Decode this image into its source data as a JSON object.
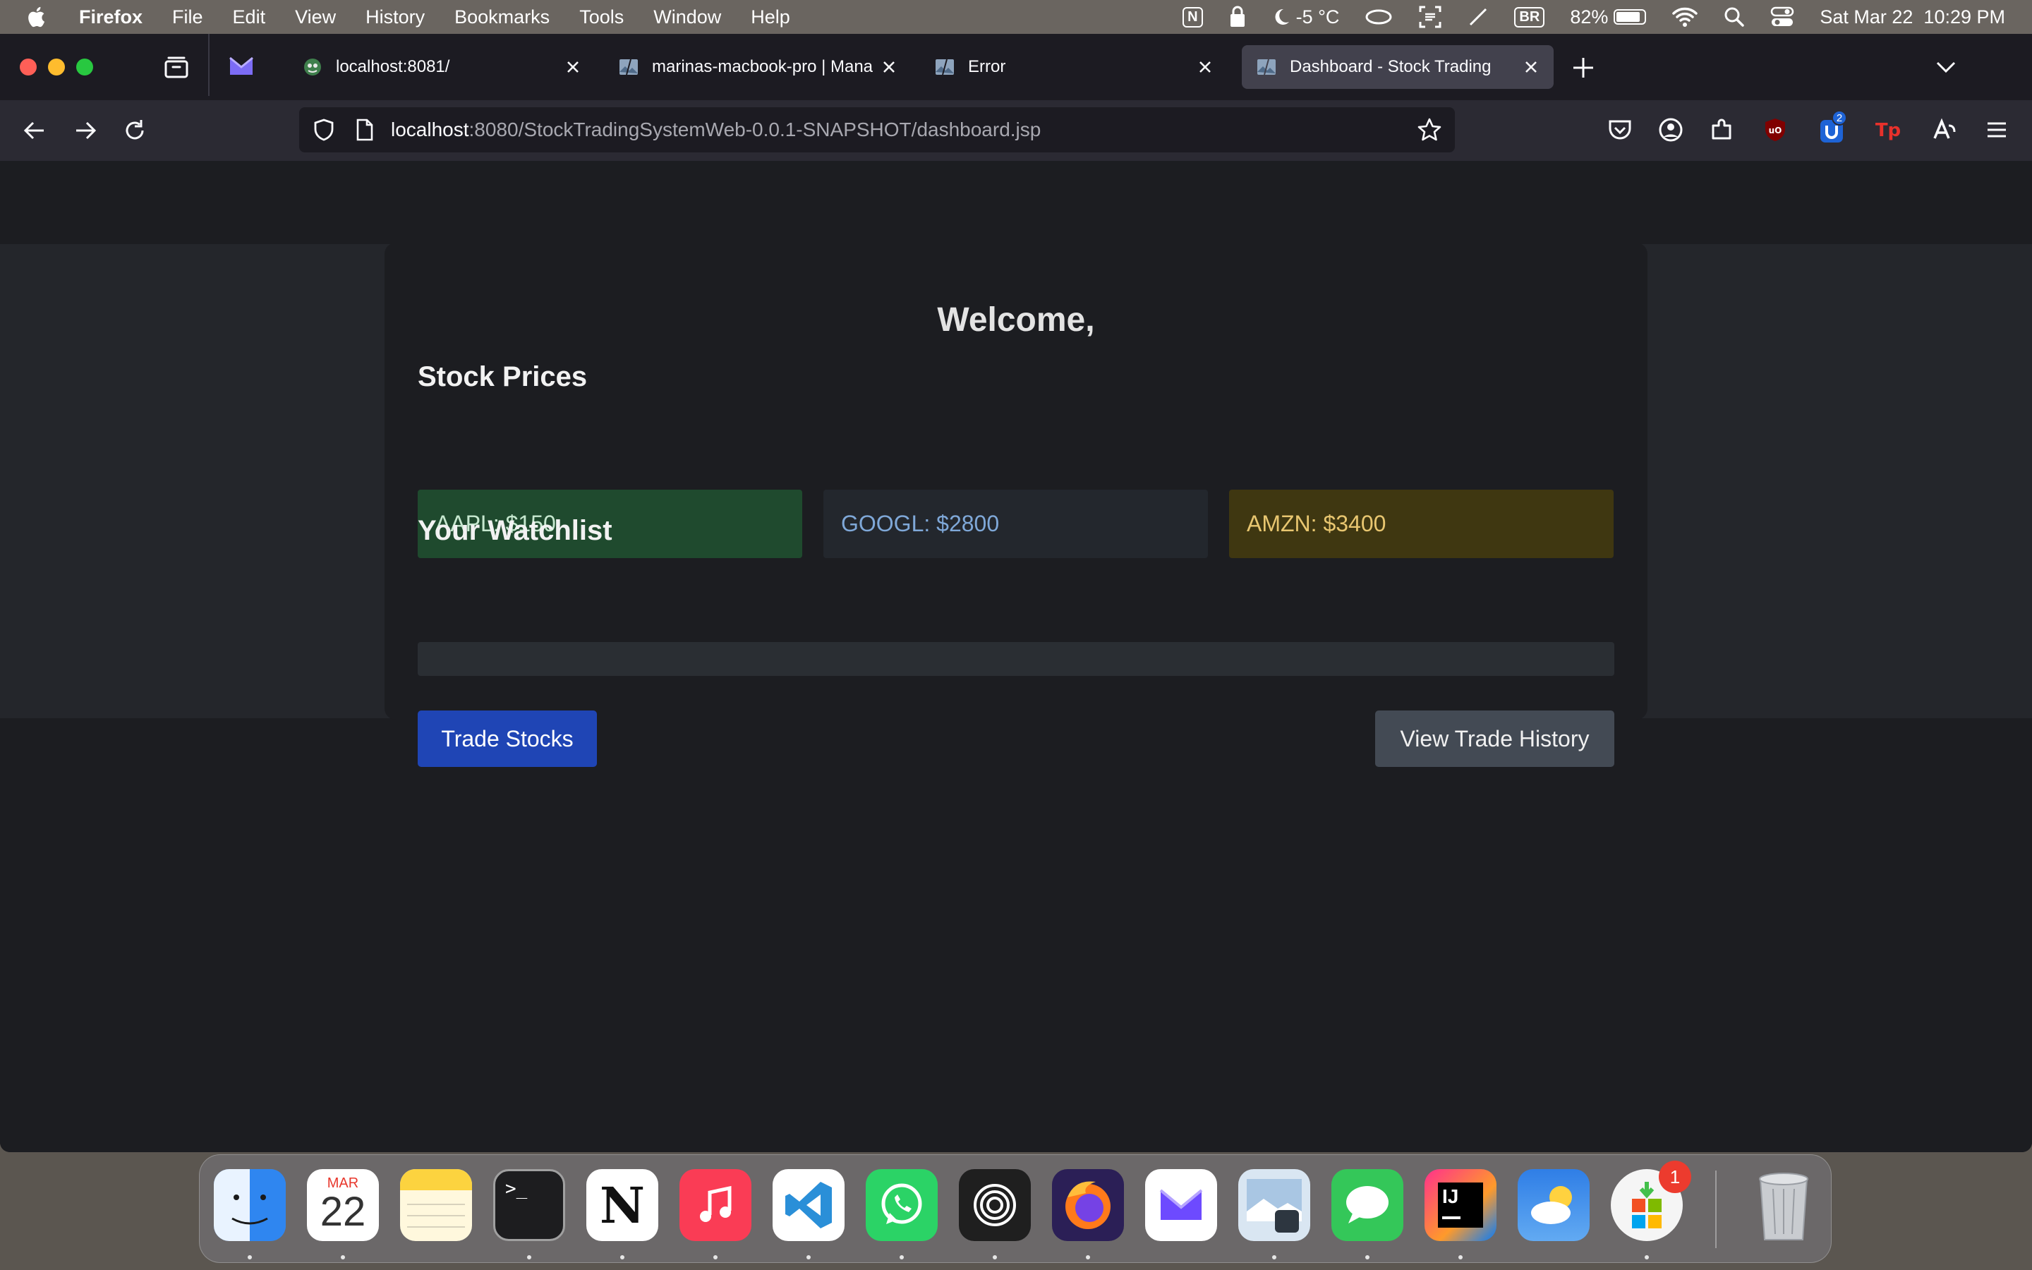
{
  "menubar": {
    "app_name": "Firefox",
    "menus": [
      "File",
      "Edit",
      "View",
      "History",
      "Bookmarks",
      "Tools",
      "Window",
      "Help"
    ],
    "temperature": "-5 °C",
    "keyboard_layout": "BR",
    "battery_percent": "82%",
    "battery_level": 0.82,
    "datetime": "Sat Mar 22  10:29 PM"
  },
  "browser": {
    "tabs": [
      {
        "label": "localhost:8081/",
        "icon": "hosting-favicon-icon"
      },
      {
        "label": "marinas-macbook-pro | Manage",
        "icon": "broken-image-favicon-icon"
      },
      {
        "label": "Error",
        "icon": "broken-image-favicon-icon"
      },
      {
        "label": "Dashboard - Stock Trading",
        "icon": "broken-image-favicon-icon"
      }
    ],
    "url": {
      "host": "localhost",
      "path": ":8080/StockTradingSystemWeb-0.0.1-SNAPSHOT/dashboard.jsp"
    },
    "extension_badge": "2"
  },
  "page": {
    "welcome": "Welcome,",
    "stock_prices_title": "Stock Prices",
    "stocks": [
      {
        "text": "AAPL: $150",
        "color": "#1f4a2e"
      },
      {
        "text": "GOOGL: $2800",
        "color": "#23272d"
      },
      {
        "text": "AMZN: $3400",
        "color": "#3f3711"
      }
    ],
    "watchlist_title": "Your Watchlist",
    "trade_button": "Trade Stocks",
    "history_button": "View Trade History"
  },
  "dock": {
    "calendar_month": "MAR",
    "calendar_day": "22",
    "badge_count": "1",
    "apps": [
      "finder-icon",
      "calendar-icon",
      "notes-icon",
      "terminal-icon",
      "notion-icon",
      "music-icon",
      "vscode-icon",
      "whatsapp-icon",
      "perplexity-icon",
      "firefox-icon",
      "proton-mail-icon",
      "preview-icon",
      "messages-icon",
      "intellij-icon",
      "weather-icon",
      "app-store-installer-icon",
      "trash-icon"
    ]
  },
  "colors": {
    "accent_button": "#1f45b5",
    "secondary_button": "#434a54",
    "page_background": "#1c1d21"
  }
}
